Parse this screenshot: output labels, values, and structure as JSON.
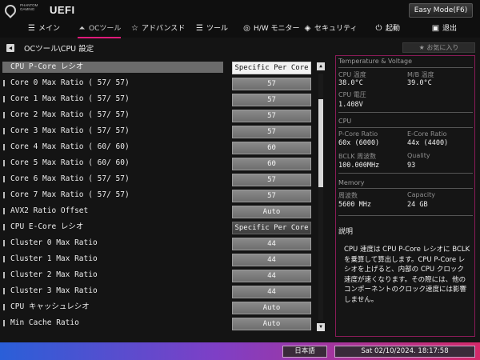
{
  "header": {
    "brand_small": "PHANTOM GAMING",
    "brand": "UEFI",
    "mode_button": "Easy Mode(F6)"
  },
  "tabs": [
    {
      "icon": "main-icon",
      "glyph": "☰",
      "label": "メイン"
    },
    {
      "icon": "oc-tweaker-icon",
      "glyph": "⏶",
      "label": "OCツール"
    },
    {
      "icon": "advanced-icon",
      "glyph": "☆",
      "label": "アドバンスド"
    },
    {
      "icon": "tool-icon",
      "glyph": "☰",
      "label": "ツール"
    },
    {
      "icon": "hw-monitor-icon",
      "glyph": "◎",
      "label": "H/W モニター"
    },
    {
      "icon": "security-icon",
      "glyph": "◈",
      "label": "セキュリティ"
    },
    {
      "icon": "boot-icon",
      "glyph": "⏻",
      "label": "起動"
    },
    {
      "icon": "exit-icon",
      "glyph": "▣",
      "label": "退出"
    }
  ],
  "breadcrumb": "OCツール\\CPU 設定",
  "favorite_button": "★ お気に入り",
  "settings": [
    {
      "label": "CPU P-Core レシオ",
      "value": "Specific Per Core"
    },
    {
      "label": "Core 0 Max Ratio ( 57/ 57)",
      "value": "57"
    },
    {
      "label": "Core 1 Max Ratio ( 57/ 57)",
      "value": "57"
    },
    {
      "label": "Core 2 Max Ratio ( 57/ 57)",
      "value": "57"
    },
    {
      "label": "Core 3 Max Ratio ( 57/ 57)",
      "value": "57"
    },
    {
      "label": "Core 4 Max Ratio ( 60/ 60)",
      "value": "60"
    },
    {
      "label": "Core 5 Max Ratio ( 60/ 60)",
      "value": "60"
    },
    {
      "label": "Core 6 Max Ratio ( 57/ 57)",
      "value": "57"
    },
    {
      "label": "Core 7 Max Ratio ( 57/ 57)",
      "value": "57"
    },
    {
      "label": "AVX2 Ratio Offset",
      "value": "Auto"
    },
    {
      "label": "CPU E-Core レシオ",
      "value": "Specific Per Core"
    },
    {
      "label": "Cluster 0 Max Ratio",
      "value": "44"
    },
    {
      "label": "Cluster 1 Max Ratio",
      "value": "44"
    },
    {
      "label": "Cluster 2 Max Ratio",
      "value": "44"
    },
    {
      "label": "Cluster 3 Max Ratio",
      "value": "44"
    },
    {
      "label": "CPU  キャッシュレシオ",
      "value": "Auto"
    },
    {
      "label": "Min Cache  Ratio",
      "value": "Auto"
    }
  ],
  "panel": {
    "title": "Temperature & Voltage",
    "cpu_temp_label": "CPU 温度",
    "cpu_temp": "38.0°C",
    "mb_temp_label": "M/B 温度",
    "mb_temp": "39.0°C",
    "cpu_volt_label": "CPU 電圧",
    "cpu_volt": "1.408V",
    "cpu_section": "CPU",
    "pcore_label": "P-Core Ratio",
    "pcore": "60x (6000)",
    "ecore_label": "E-Core Ratio",
    "ecore": "44x (4400)",
    "bclk_label": "BCLK 周波数",
    "bclk": "100.000MHz",
    "quality_label": "Quality",
    "quality": "93",
    "memory_section": "Memory",
    "freq_label": "周波数",
    "freq": "5600 MHz",
    "capacity_label": "Capacity",
    "capacity": "24 GB",
    "desc_title": "説明",
    "desc_text": "CPU 速度は CPU P-Core レシオに BCLK を乗算して算出します。CPU P-Core レシオを上げると、内部の CPU クロック速度が速くなります。その際には、他のコンポーネントのクロック速度には影響しません。"
  },
  "footer": {
    "language": "日本語",
    "datetime": "Sat 02/10/2024. 18:17:58"
  }
}
